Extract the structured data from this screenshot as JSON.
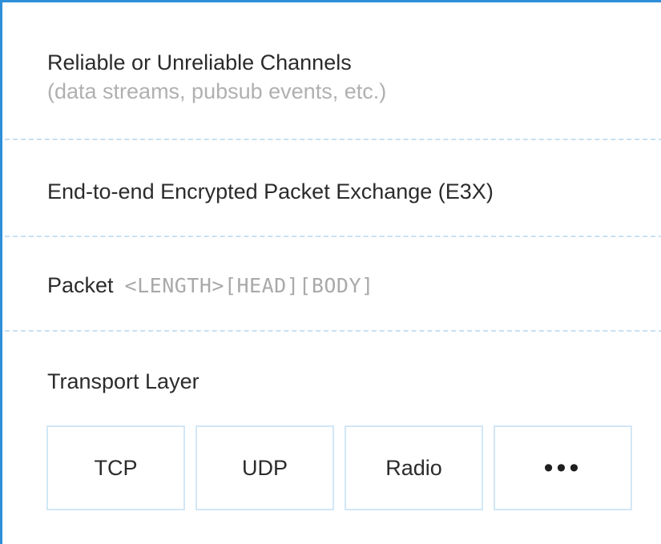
{
  "layers": {
    "channels": {
      "title": "Reliable or Unreliable Channels",
      "subtitle": "(data streams, pubsub events, etc.)"
    },
    "e3x": {
      "title": "End-to-end Encrypted Packet Exchange (E3X)"
    },
    "packet": {
      "title": "Packet",
      "format": "<LENGTH>[HEAD][BODY]"
    },
    "transport": {
      "title": "Transport Layer",
      "items": [
        {
          "label": "TCP"
        },
        {
          "label": "UDP"
        },
        {
          "label": "Radio"
        },
        {
          "label": "•••"
        }
      ]
    }
  },
  "colors": {
    "frame_border": "#2e8fd9",
    "divider": "#c9e1f1",
    "box_border": "#d2e7f6",
    "muted_text": "#b0b0b0"
  }
}
